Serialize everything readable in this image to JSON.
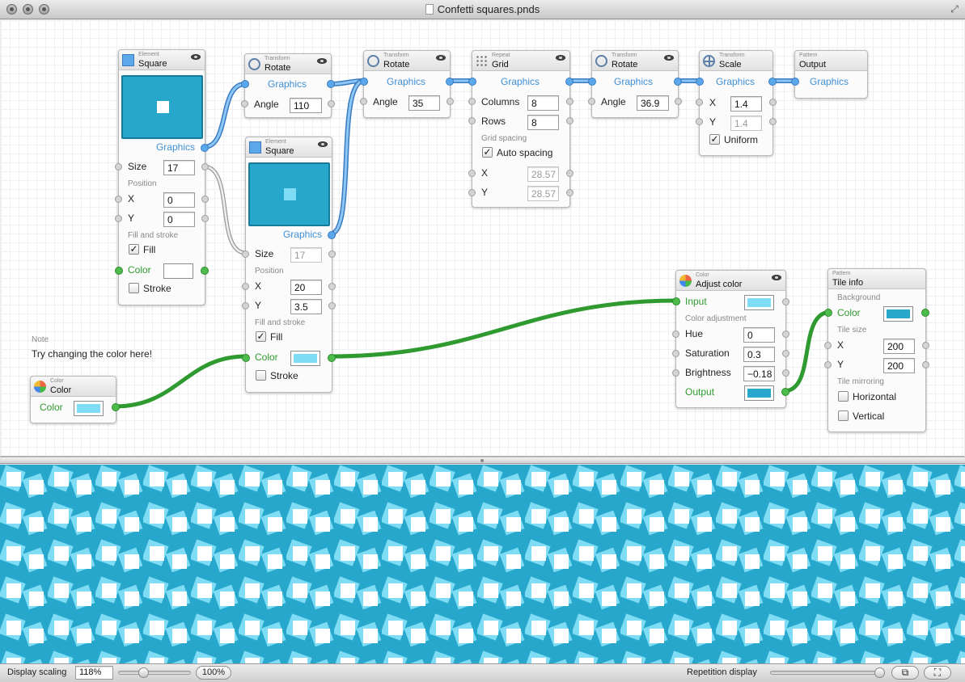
{
  "window": {
    "title": "Confetti squares.pnds"
  },
  "colors": {
    "blue_wire": "#5aa7ea",
    "green_wire": "#4cbd4c",
    "preview_blue": "#27a7cb",
    "light_blue": "#7fdcf5"
  },
  "nodes": {
    "square1": {
      "category": "Element",
      "title": "Square",
      "graphics": "Graphics",
      "size_label": "Size",
      "size": "17",
      "position_label": "Position",
      "x_label": "X",
      "x": "0",
      "y_label": "Y",
      "y": "0",
      "fill_stroke_label": "Fill and stroke",
      "fill_label": "Fill",
      "color_label": "Color",
      "stroke_label": "Stroke",
      "color": "#ffffff"
    },
    "rotate1": {
      "category": "Transform",
      "title": "Rotate",
      "graphics": "Graphics",
      "angle_label": "Angle",
      "angle": "110"
    },
    "square2": {
      "category": "Element",
      "title": "Square",
      "graphics": "Graphics",
      "size_label": "Size",
      "size": "17",
      "position_label": "Position",
      "x_label": "X",
      "x": "20",
      "y_label": "Y",
      "y": "3.5",
      "fill_stroke_label": "Fill and stroke",
      "fill_label": "Fill",
      "color_label": "Color",
      "stroke_label": "Stroke",
      "color": "#7fdcf5"
    },
    "rotate2": {
      "category": "Transform",
      "title": "Rotate",
      "graphics": "Graphics",
      "angle_label": "Angle",
      "angle": "35"
    },
    "grid": {
      "category": "Repeat",
      "title": "Grid",
      "graphics": "Graphics",
      "columns_label": "Columns",
      "columns": "8",
      "rows_label": "Rows",
      "rows": "8",
      "spacing_label": "Grid spacing",
      "auto_label": "Auto spacing",
      "x_label": "X",
      "x": "28.57",
      "y_label": "Y",
      "y": "28.57"
    },
    "rotate3": {
      "category": "Transform",
      "title": "Rotate",
      "graphics": "Graphics",
      "angle_label": "Angle",
      "angle": "36.9"
    },
    "scale": {
      "category": "Transform",
      "title": "Scale",
      "graphics": "Graphics",
      "x_label": "X",
      "x": "1.4",
      "y_label": "Y",
      "y": "1.4",
      "uniform_label": "Uniform"
    },
    "output": {
      "category": "Pattern",
      "title": "Output",
      "graphics": "Graphics"
    },
    "adjust": {
      "category": "Color",
      "title": "Adjust color",
      "input_label": "Input",
      "section_label": "Color adjustment",
      "hue_label": "Hue",
      "hue": "0",
      "sat_label": "Saturation",
      "sat": "0.3",
      "bri_label": "Brightness",
      "bri": "−0.18",
      "output_label": "Output",
      "input_color": "#7fdcf5",
      "output_color": "#27a7cb"
    },
    "tileinfo": {
      "category": "Pattern",
      "title": "Tile info",
      "bg_label": "Background",
      "color_label": "Color",
      "tile_size_label": "Tile size",
      "x_label": "X",
      "x": "200",
      "y_label": "Y",
      "y": "200",
      "mirroring_label": "Tile mirroring",
      "horizontal_label": "Horizontal",
      "vertical_label": "Vertical",
      "color": "#27a7cb"
    },
    "color": {
      "category": "Color",
      "title": "Color",
      "color_label": "Color",
      "color": "#7fdcf5"
    }
  },
  "note": {
    "label": "Note",
    "text": "Try changing the color here!"
  },
  "statusbar": {
    "display_scaling_label": "Display scaling",
    "scaling_value": "118%",
    "scaling_fraction": 0.32,
    "reset_label": "100%",
    "repetition_label": "Repetition display",
    "repetition_fraction": 1.0
  }
}
